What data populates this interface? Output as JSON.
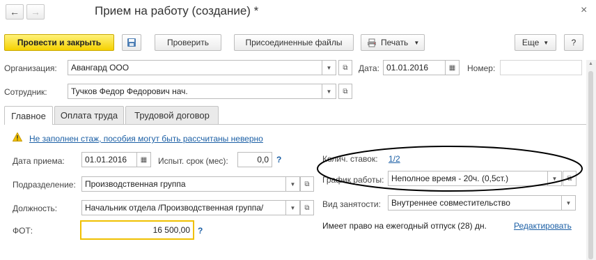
{
  "window": {
    "title": "Прием на работу (создание) *",
    "close_glyph": "×",
    "back_glyph": "←",
    "forward_glyph": "→"
  },
  "toolbar": {
    "post_close": "Провести и закрыть",
    "check": "Проверить",
    "attached": "Присоединенные файлы",
    "print": "Печать",
    "more": "Еще",
    "help": "?"
  },
  "header": {
    "org_label": "Организация:",
    "org_value": "Авангард ООО",
    "date_label": "Дата:",
    "date_value": "01.01.2016",
    "number_label": "Номер:",
    "number_value": "",
    "employee_label": "Сотрудник:",
    "employee_value": "Тучков Федор Федорович нач."
  },
  "tabs": [
    {
      "label": "Главное"
    },
    {
      "label": "Оплата труда"
    },
    {
      "label": "Трудовой договор"
    }
  ],
  "main": {
    "warning": "Не заполнен стаж, пособия могут быть рассчитаны неверно",
    "hire_date_label": "Дата приема:",
    "hire_date_value": "01.01.2016",
    "probation_label": "Испыт. срок (мес):",
    "probation_value": "0,0",
    "division_label": "Подразделение:",
    "division_value": "Производственная группа",
    "position_label": "Должность:",
    "position_value": "Начальник отдела /Производственная группа/",
    "fot_label": "ФОТ:",
    "fot_value": "16 500,00",
    "help_q": "?",
    "rates_label": "Колич. ставок:",
    "rates_value": "1/2",
    "schedule_label": "График работы:",
    "schedule_value": "Неполное время - 20ч. (0,5ст.)",
    "employment_label": "Вид занятости:",
    "employment_value": "Внутреннее совместительство",
    "vacation_text": "Имеет право на ежегодный отпуск (28) дн.",
    "edit_link": "Редактировать"
  },
  "colors": {
    "primary_button": "#f5d100",
    "link": "#1b5fa5",
    "focus_border": "#f0c000",
    "annotation_ellipse": "#000000"
  }
}
